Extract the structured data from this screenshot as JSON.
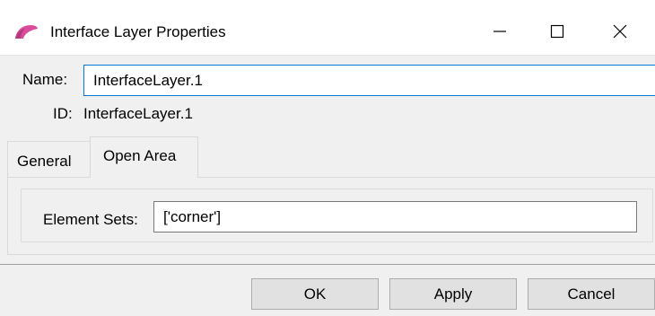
{
  "window": {
    "title": "Interface Layer Properties",
    "icons": {
      "app": "app-logo-icon",
      "minimize": "minimize-icon",
      "maximize": "maximize-icon",
      "close": "close-icon"
    }
  },
  "form": {
    "name_label": "Name:",
    "name_value": "InterfaceLayer.1",
    "id_label": "ID:",
    "id_value": "InterfaceLayer.1"
  },
  "tabs": [
    {
      "label": "General",
      "selected": false
    },
    {
      "label": "Open Area",
      "selected": true
    }
  ],
  "open_area": {
    "element_sets_label": "Element Sets:",
    "element_sets_value": "['corner']"
  },
  "buttons": {
    "ok": "OK",
    "apply": "Apply",
    "cancel": "Cancel"
  },
  "colors": {
    "app_icon": "#d94c9a",
    "focus_border": "#0078d7"
  }
}
